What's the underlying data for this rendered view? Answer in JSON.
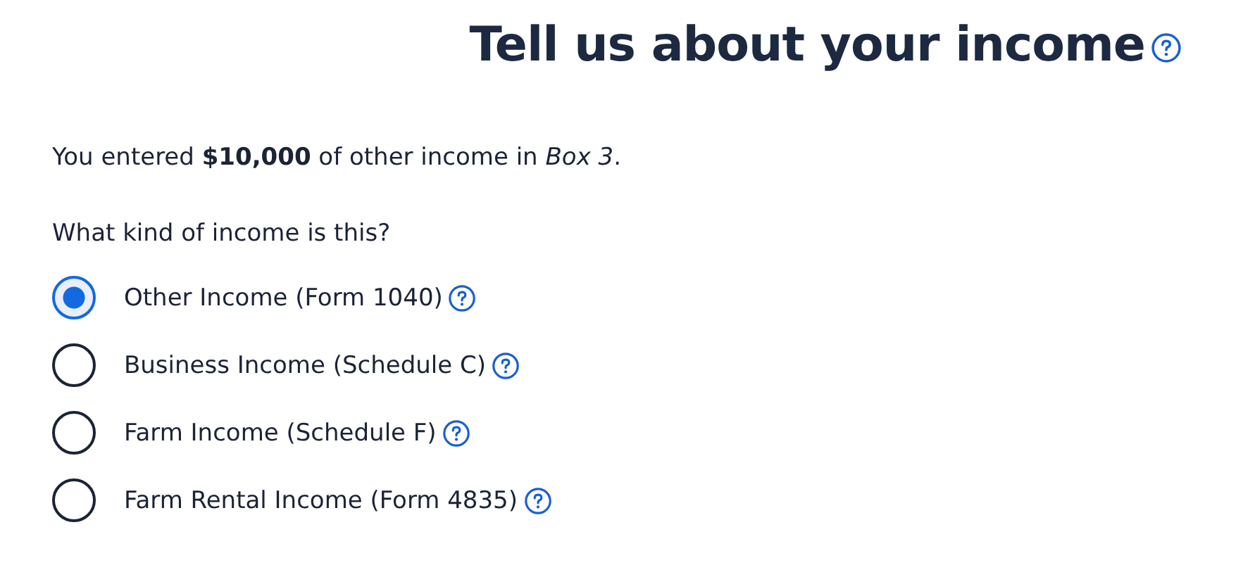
{
  "title": "Tell us about your income",
  "intro": "You entered **$10,000** of other income in *Box 3*.",
  "question": "What kind of income is this?",
  "options": [
    {
      "label": "Other Income (Form 1040)",
      "selected": true
    },
    {
      "label": "Business Income (Schedule C)",
      "selected": false
    },
    {
      "label": "Farm Income (Schedule F)",
      "selected": false
    },
    {
      "label": "Farm Rental Income (Form 4835)",
      "selected": false
    }
  ]
}
